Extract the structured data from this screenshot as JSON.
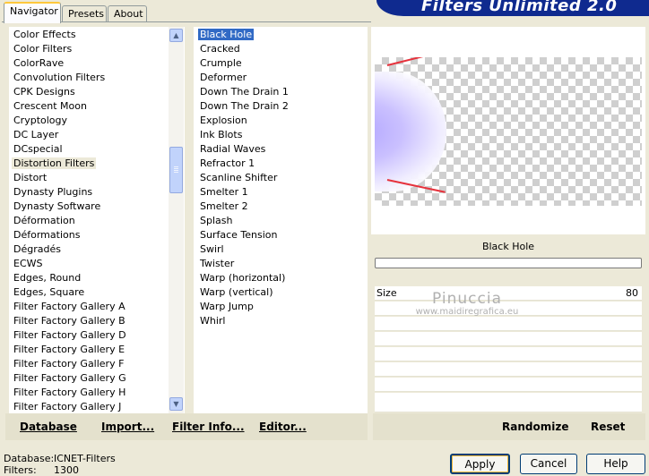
{
  "tabs": [
    {
      "label": "Navigator",
      "active": true
    },
    {
      "label": "Presets",
      "active": false
    },
    {
      "label": "About",
      "active": false
    }
  ],
  "header": {
    "title": "Filters Unlimited 2.0"
  },
  "categories": {
    "selected": "Distortion Filters",
    "items": [
      "Color Effects",
      "Color Filters",
      "ColorRave",
      "Convolution Filters",
      "CPK Designs",
      "Crescent Moon",
      "Cryptology",
      "DC Layer",
      "DCspecial",
      "Distortion Filters",
      "Distort",
      "Dynasty Plugins",
      "Dynasty Software",
      "Déformation",
      "Déformations",
      "Dégradés",
      "ECWS",
      "Edges, Round",
      "Edges, Square",
      "Filter Factory Gallery A",
      "Filter Factory Gallery B",
      "Filter Factory Gallery D",
      "Filter Factory Gallery E",
      "Filter Factory Gallery F",
      "Filter Factory Gallery G",
      "Filter Factory Gallery H",
      "Filter Factory Gallery J"
    ]
  },
  "filters": {
    "selected": "Black Hole",
    "items": [
      "Black Hole",
      "Cracked",
      "Crumple",
      "Deformer",
      "Down The Drain 1",
      "Down The Drain 2",
      "Explosion",
      "Ink Blots",
      "Radial Waves",
      "Refractor 1",
      "Scanline Shifter",
      "Smelter 1",
      "Smelter 2",
      "Splash",
      "Surface Tension",
      "Swirl",
      "Twister",
      "Warp (horizontal)",
      "Warp (vertical)",
      "Warp Jump",
      "Whirl"
    ]
  },
  "preview": {
    "filter_name": "Black Hole",
    "hole_color": "#b3a7ff",
    "rim_color": "#e6323c"
  },
  "parameters": [
    {
      "label": "Size",
      "value": "80"
    }
  ],
  "watermark": {
    "line1": "Pinuccia",
    "line2": "www.maidiregrafica.eu"
  },
  "commands": {
    "database": "Database",
    "import": "Import...",
    "filter_info": "Filter Info...",
    "editor": "Editor...",
    "randomize": "Randomize",
    "reset": "Reset"
  },
  "footer": {
    "database_label": "Database:",
    "database_value": "ICNET-Filters",
    "filters_label": "Filters:",
    "filters_value": "1300"
  },
  "buttons": {
    "apply": "Apply",
    "cancel": "Cancel",
    "help": "Help"
  },
  "colors": {
    "selection": "#316ac5",
    "banner": "#0f2a8f",
    "dialog_bg": "#ece9d8"
  }
}
